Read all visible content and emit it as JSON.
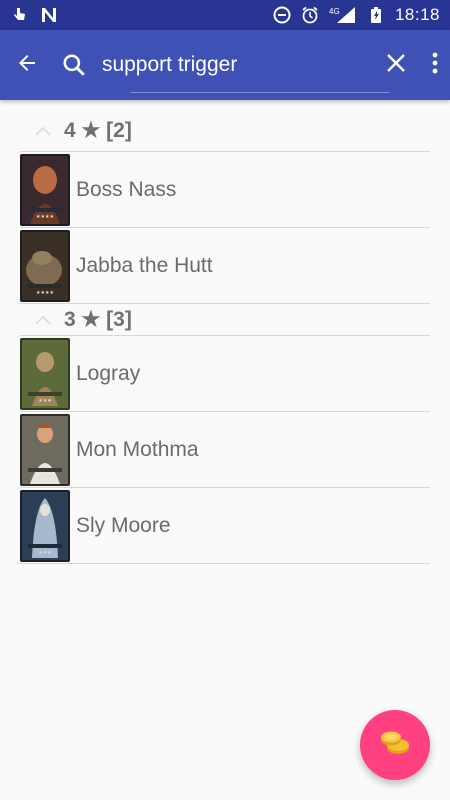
{
  "status_bar": {
    "time": "18:18",
    "network": "4G",
    "icons": [
      "touch-icon",
      "n-notification-icon",
      "do-not-disturb-icon",
      "alarm-icon",
      "signal-icon",
      "battery-icon"
    ]
  },
  "toolbar": {
    "search_value": "support trigger",
    "icons": [
      "back-arrow-icon",
      "search-icon",
      "close-icon",
      "overflow-menu-icon"
    ],
    "background": "#3f51b5",
    "status_background": "#283593"
  },
  "groups": [
    {
      "header": "4 ★ [2]",
      "items": [
        {
          "name": "Boss Nass",
          "thumb_colors": [
            "#4a2a20",
            "#b86b45",
            "#1a1a2a"
          ]
        },
        {
          "name": "Jabba the Hutt",
          "thumb_colors": [
            "#3a3026",
            "#7f6b52",
            "#1e1e1e"
          ]
        }
      ]
    },
    {
      "header": "3 ★ [3]",
      "items": [
        {
          "name": "Logray",
          "thumb_colors": [
            "#5d6b3a",
            "#b79a6b",
            "#2f3a20"
          ]
        },
        {
          "name": "Mon Mothma",
          "thumb_colors": [
            "#6e6a5f",
            "#e9e6de",
            "#2a2a2a"
          ]
        },
        {
          "name": "Sly Moore",
          "thumb_colors": [
            "#2c3e56",
            "#a8b8cc",
            "#1a1f2a"
          ]
        }
      ]
    }
  ],
  "fab": {
    "icon": "coins-icon",
    "color": "#ff4081"
  }
}
